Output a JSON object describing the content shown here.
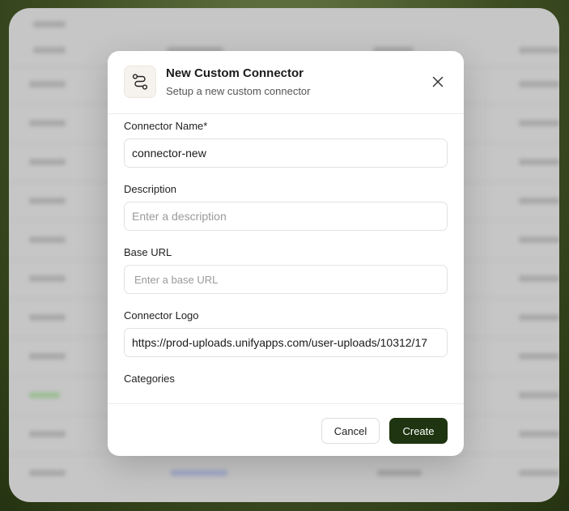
{
  "modal": {
    "title": "New Custom Connector",
    "subtitle": "Setup a new custom connector",
    "icon": "route-icon",
    "fields": {
      "name_label": "Connector Name*",
      "name_value": "connector-new",
      "description_label": "Description",
      "description_placeholder": "Enter a description",
      "base_url_label": "Base URL",
      "base_url_placeholder": "Enter a base URL",
      "logo_label": "Connector Logo",
      "logo_value": "https://prod-uploads.unifyapps.com/user-uploads/10312/17",
      "categories_label": "Categories"
    },
    "footer": {
      "cancel_label": "Cancel",
      "create_label": "Create"
    }
  },
  "colors": {
    "primary_button": "#1f3410",
    "backdrop": "#c6c6c6",
    "outer_background": "#3f4f23"
  }
}
